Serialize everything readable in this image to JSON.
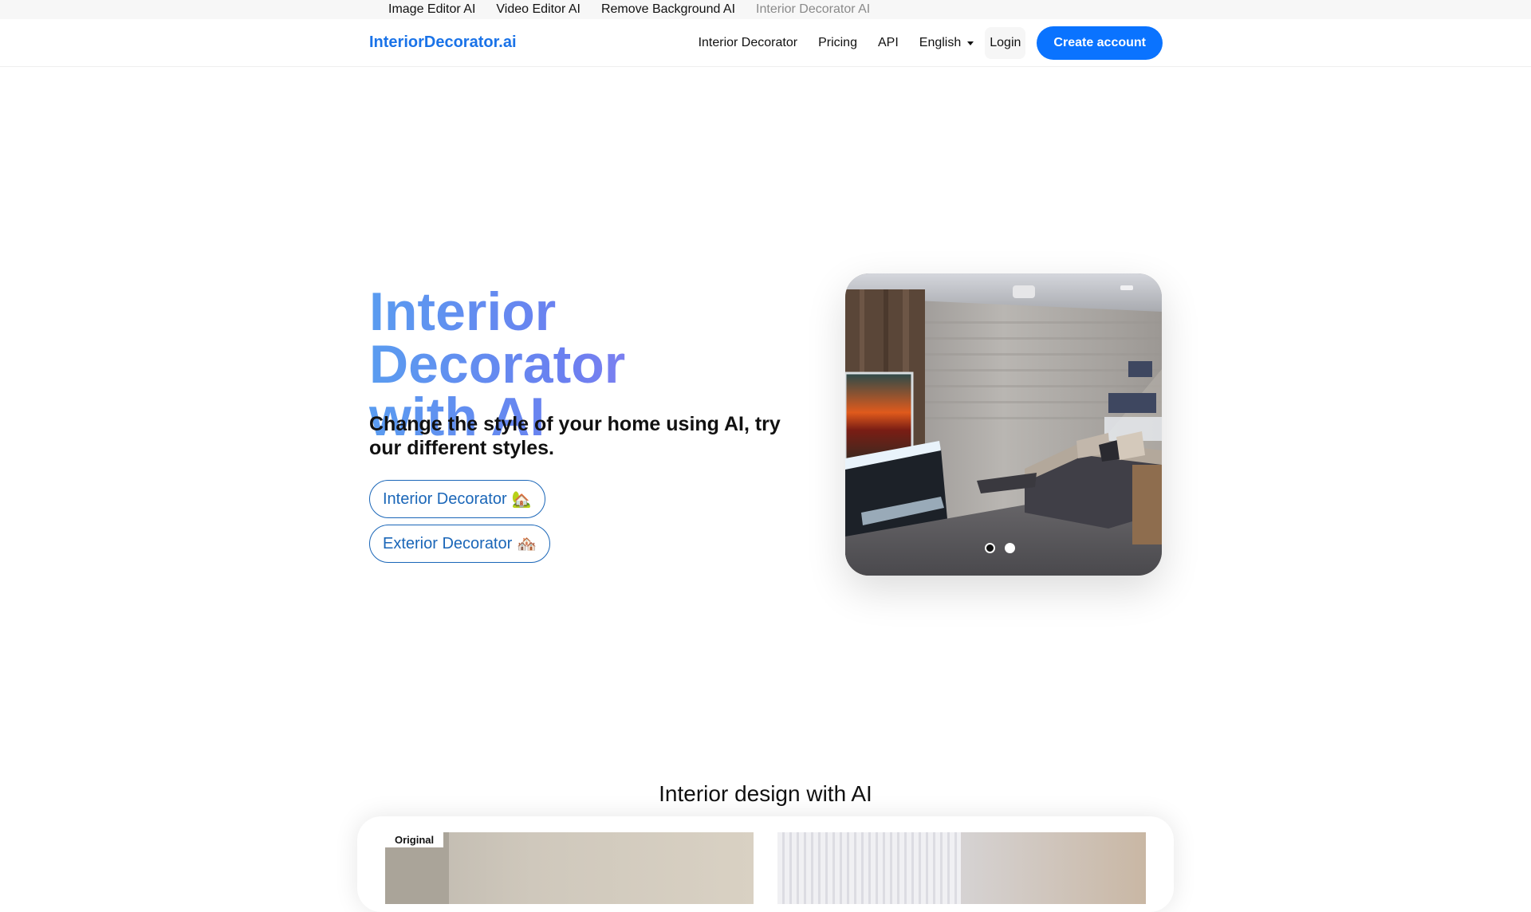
{
  "topbar": {
    "links": [
      {
        "label": "Image Editor AI"
      },
      {
        "label": "Video Editor AI"
      },
      {
        "label": "Remove Background AI"
      },
      {
        "label": "Interior Decorator AI"
      }
    ]
  },
  "header": {
    "brand": "InteriorDecorator.ai",
    "nav": {
      "interior_decorator": "Interior Decorator",
      "pricing": "Pricing",
      "api": "API",
      "language": "English",
      "login": "Login",
      "create_account": "Create account"
    }
  },
  "hero": {
    "title_line1": "Interior Decorator",
    "title_line2": "with AI",
    "subtitle": "Change the style of your home using AI, try our different styles.",
    "buttons": [
      {
        "label": "Interior Decorator",
        "emoji": "🏡"
      },
      {
        "label": "Exterior Decorator",
        "emoji": "🏘️"
      }
    ],
    "carousel": {
      "slide_count": 2,
      "active_index": 0
    }
  },
  "section": {
    "title": "Interior design with AI",
    "compare": {
      "left_label": "Original"
    }
  },
  "colors": {
    "brand_blue": "#1a73e8",
    "cta_blue": "#0a73ff",
    "pill_blue": "#1a66b8",
    "gradient_start": "#5a9cf0",
    "gradient_end": "#b585f0"
  }
}
